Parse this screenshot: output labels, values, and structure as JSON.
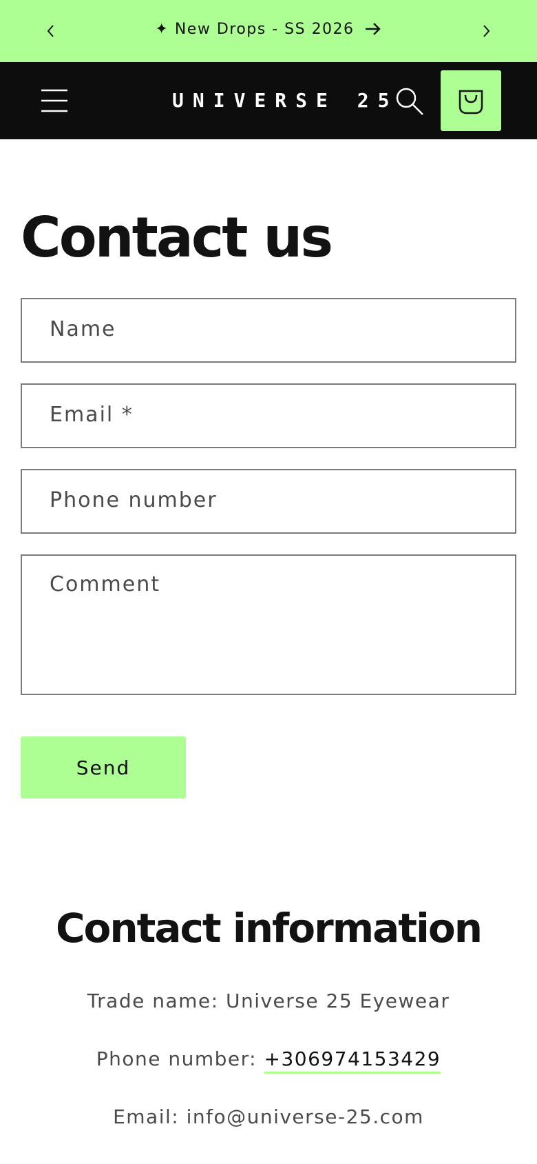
{
  "announcement": {
    "text": "✦ New Drops - SS 2026"
  },
  "header": {
    "logo": "UNIVERSE 25"
  },
  "page": {
    "title": "Contact us"
  },
  "form": {
    "name_placeholder": "Name",
    "email_placeholder": "Email *",
    "phone_placeholder": "Phone number",
    "comment_placeholder": "Comment",
    "send_label": "Send"
  },
  "contact_info": {
    "heading": "Contact information",
    "trade_name": "Trade name: Universe 25 Eyewear",
    "phone_label": "Phone number: ",
    "phone_value": "+306974153429",
    "email": "Email: info@universe-25.com"
  },
  "colors": {
    "accent": "#adff94",
    "header_bg": "#0d0d0d",
    "text": "#121212"
  }
}
